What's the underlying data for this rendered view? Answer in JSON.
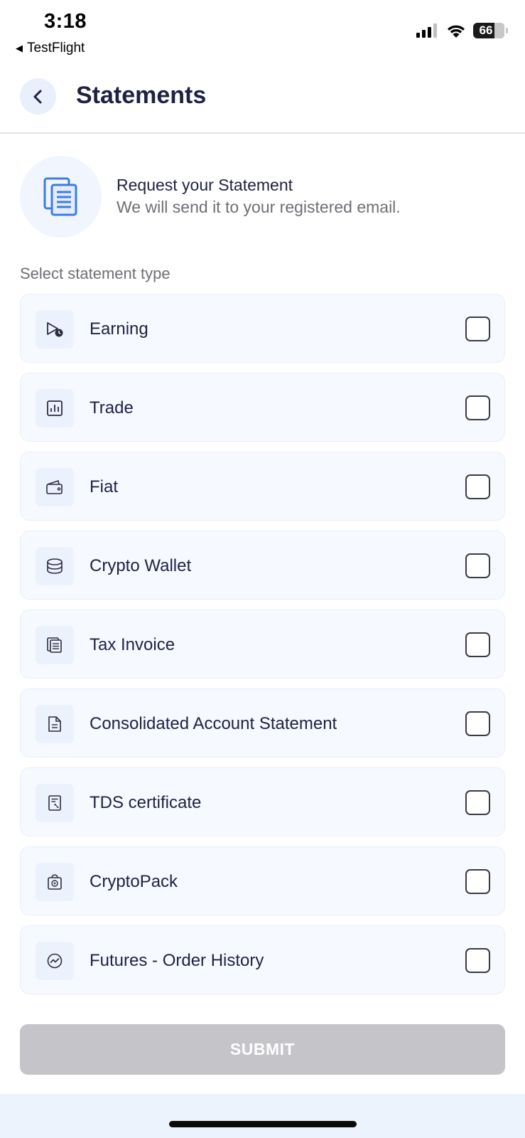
{
  "status_bar": {
    "time": "3:18",
    "back_app": "TestFlight",
    "battery_level": "66",
    "icons": [
      "cellular-signal-icon",
      "wifi-icon",
      "battery-icon"
    ]
  },
  "header": {
    "title": "Statements",
    "back_icon": "chevron-left-icon"
  },
  "info": {
    "title": "Request your Statement",
    "subtitle": "We will send it to your registered email.",
    "icon": "document-stack-icon"
  },
  "section_label": "Select statement type",
  "options": [
    {
      "label": "Earning",
      "icon": "earning-icon",
      "checked": false
    },
    {
      "label": "Trade",
      "icon": "bar-chart-icon",
      "checked": false
    },
    {
      "label": "Fiat",
      "icon": "wallet-icon",
      "checked": false
    },
    {
      "label": "Crypto Wallet",
      "icon": "coins-stack-icon",
      "checked": false
    },
    {
      "label": "Tax Invoice",
      "icon": "invoice-icon",
      "checked": false
    },
    {
      "label": "Consolidated Account Statement",
      "icon": "document-icon",
      "checked": false
    },
    {
      "label": "TDS certificate",
      "icon": "tax-certificate-icon",
      "checked": false
    },
    {
      "label": "CryptoPack",
      "icon": "shopping-bag-icon",
      "checked": false
    },
    {
      "label": "Futures - Order History",
      "icon": "trend-circle-icon",
      "checked": false
    }
  ],
  "submit_label": "SUBMIT",
  "colors": {
    "primary_text": "#1f2144",
    "secondary_text": "#6e6e76",
    "accent_blue": "#3d7be8",
    "option_bg": "#f6f9ff",
    "submit_disabled": "#c4c4c9"
  }
}
